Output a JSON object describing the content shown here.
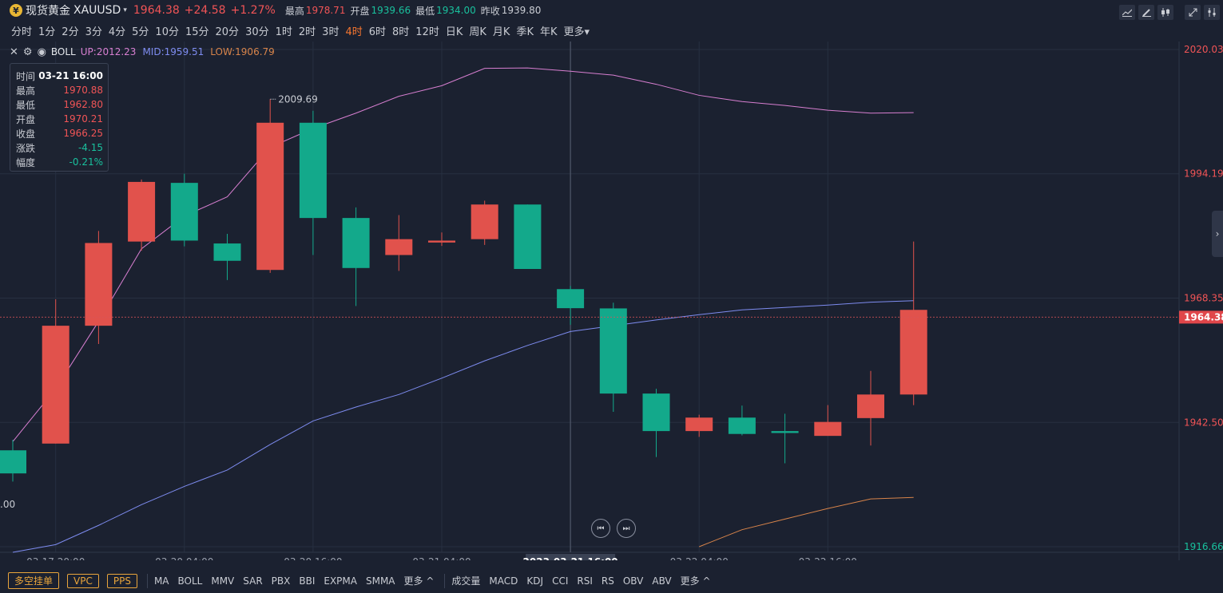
{
  "header": {
    "coin_glyph": "¥",
    "name": "现货黄金",
    "symbol": "XAUUSD",
    "symbol_caret": "▾",
    "price": "1964.38",
    "change": "+24.58",
    "change_pct": "+1.27%",
    "high_label": "最高",
    "high": "1978.71",
    "open_label": "开盘",
    "open": "1939.66",
    "low_label": "最低",
    "low": "1934.00",
    "prev_label": "昨收",
    "prev": "1939.80",
    "tools": [
      "line-chart-icon",
      "pencil-icon",
      "candles-icon",
      "expand-icon",
      "settings-icon"
    ]
  },
  "periods": {
    "items": [
      "分时",
      "1分",
      "2分",
      "3分",
      "4分",
      "5分",
      "10分",
      "15分",
      "20分",
      "30分",
      "1时",
      "2时",
      "3时",
      "4时",
      "6时",
      "8时",
      "12时",
      "日K",
      "周K",
      "月K",
      "季K",
      "年K",
      "更多▾"
    ],
    "active_index": 13
  },
  "indicator": {
    "name": "BOLL",
    "up_label": "UP:2012.23",
    "mid_label": "MID:1959.51",
    "low_label": "LOW:1906.79",
    "colors": {
      "up": "#d87fd1",
      "mid": "#7e8cf0",
      "low": "#d8844a"
    }
  },
  "info_box": {
    "rows": [
      {
        "k": "时间",
        "v": "03-21 16:00"
      },
      {
        "k": "最高",
        "v": "1970.88"
      },
      {
        "k": "最低",
        "v": "1962.80"
      },
      {
        "k": "开盘",
        "v": "1970.21"
      },
      {
        "k": "收盘",
        "v": "1966.25"
      },
      {
        "k": "涨跌",
        "v": "-4.15"
      },
      {
        "k": "幅度",
        "v": "-0.21%"
      }
    ]
  },
  "nav": {
    "prev_glyph": "⏮",
    "next_glyph": "⏭",
    "right_glyph": "›"
  },
  "bottom": {
    "buttons": [
      "多空挂单",
      "VPC",
      "PPS"
    ],
    "group1": [
      "MA",
      "BOLL",
      "MMV",
      "SAR",
      "PBX",
      "BBI",
      "EXPMA",
      "SMMA",
      "更多 ^"
    ],
    "group2": [
      "成交量",
      "MACD",
      "KDJ",
      "CCI",
      "RSI",
      "RS",
      "OBV",
      "ABV",
      "更多 ^"
    ]
  },
  "chart_data": {
    "type": "candlestick",
    "colors": {
      "up": "#e1524c",
      "down": "#13a98b",
      "grid": "#273041",
      "price_line": "#d9545a",
      "axis_red": "#f05456",
      "axis_green": "#19c09d"
    },
    "ylim": [
      1916.66,
      2020.03
    ],
    "y_ticks": [
      2020.03,
      1994.19,
      1968.35,
      1942.5,
      1916.66
    ],
    "x_tick_labels": [
      "03-17 20:00",
      "03-20 04:00",
      "03-20 16:00",
      "03-21 04:00",
      "2023-03-21 16:00",
      "03-22 04:00",
      "03-22 16:00"
    ],
    "x_tick_index": [
      1,
      4,
      7,
      10,
      13,
      16,
      19
    ],
    "crosshair_index": 13,
    "last_price": "1964.38",
    "last_price_value": 1964.38,
    "max_label": "2009.69",
    "max_label_index": 6,
    "left_edge_label": ".00",
    "candles": [
      {
        "o": 1936.7,
        "h": 1938.9,
        "l": 1930.2,
        "c": 1931.9
      },
      {
        "o": 1938.1,
        "h": 1968.1,
        "l": 1938.1,
        "c": 1962.6
      },
      {
        "o": 1962.6,
        "h": 1982.3,
        "l": 1958.8,
        "c": 1979.8
      },
      {
        "o": 1980.1,
        "h": 1993.0,
        "l": 1978.2,
        "c": 1992.5
      },
      {
        "o": 1992.3,
        "h": 1994.2,
        "l": 1979.1,
        "c": 1980.3
      },
      {
        "o": 1979.7,
        "h": 1981.7,
        "l": 1972.1,
        "c": 1976.1
      },
      {
        "o": 1974.2,
        "h": 2009.7,
        "l": 1973.6,
        "c": 2004.8
      },
      {
        "o": 2004.8,
        "h": 2007.3,
        "l": 1977.3,
        "c": 1985.0
      },
      {
        "o": 1985.0,
        "h": 1987.2,
        "l": 1966.7,
        "c": 1974.6
      },
      {
        "o": 1977.3,
        "h": 1985.6,
        "l": 1974.0,
        "c": 1980.6
      },
      {
        "o": 1979.9,
        "h": 1982.0,
        "l": 1979.2,
        "c": 1980.3
      },
      {
        "o": 1980.6,
        "h": 1988.6,
        "l": 1979.4,
        "c": 1987.8
      },
      {
        "o": 1987.8,
        "h": 1987.8,
        "l": 1974.4,
        "c": 1974.4
      },
      {
        "o": 1970.21,
        "h": 1970.88,
        "l": 1962.8,
        "c": 1966.25
      },
      {
        "o": 1966.2,
        "h": 1967.4,
        "l": 1944.7,
        "c": 1948.5
      },
      {
        "o": 1948.5,
        "h": 1949.5,
        "l": 1935.3,
        "c": 1940.7
      },
      {
        "o": 1940.7,
        "h": 1944.1,
        "l": 1939.5,
        "c": 1943.5
      },
      {
        "o": 1943.5,
        "h": 1946.0,
        "l": 1939.8,
        "c": 1940.1
      },
      {
        "o": 1940.7,
        "h": 1944.3,
        "l": 1934.0,
        "c": 1940.3
      },
      {
        "o": 1939.7,
        "h": 1946.1,
        "l": 1939.7,
        "c": 1942.6
      },
      {
        "o": 1943.4,
        "h": 1953.2,
        "l": 1937.7,
        "c": 1948.3
      },
      {
        "o": 1948.3,
        "h": 1980.1,
        "l": 1946.1,
        "c": 1965.9
      }
    ],
    "series": [
      {
        "name": "UP",
        "color": "#d87fd1",
        "x_index": [
          0,
          1,
          2,
          3,
          4,
          5,
          6,
          7,
          8,
          9,
          10,
          11,
          12,
          13,
          14,
          15,
          16,
          17,
          18,
          19,
          20,
          21
        ],
        "values": [
          1938.5,
          1949.5,
          1963.5,
          1978.6,
          1985.4,
          1989.4,
          1999.7,
          2003.6,
          2006.8,
          2010.3,
          2012.5,
          2016.1,
          2016.2,
          2015.5,
          2014.7,
          2012.8,
          2010.5,
          2009.2,
          2008.4,
          2007.4,
          2006.8,
          2006.9
        ]
      },
      {
        "name": "MID",
        "color": "#7e8cf0",
        "x_index": [
          0,
          1,
          2,
          3,
          4,
          5,
          6,
          7,
          8,
          9,
          10,
          11,
          12,
          13,
          14,
          15,
          16,
          17,
          18,
          19,
          20,
          21
        ],
        "values": [
          1915.5,
          1917.1,
          1921.1,
          1925.4,
          1929.2,
          1932.6,
          1937.9,
          1942.8,
          1945.7,
          1948.3,
          1951.7,
          1955.3,
          1958.5,
          1961.4,
          1962.6,
          1963.8,
          1964.9,
          1965.9,
          1966.4,
          1966.9,
          1967.5,
          1967.8
        ]
      },
      {
        "name": "LOW",
        "color": "#d8844a",
        "x_index": [
          16,
          17,
          18,
          19,
          20,
          21
        ],
        "values": [
          1916.66,
          1920.2,
          1922.4,
          1924.6,
          1926.6,
          1926.9
        ]
      }
    ]
  }
}
